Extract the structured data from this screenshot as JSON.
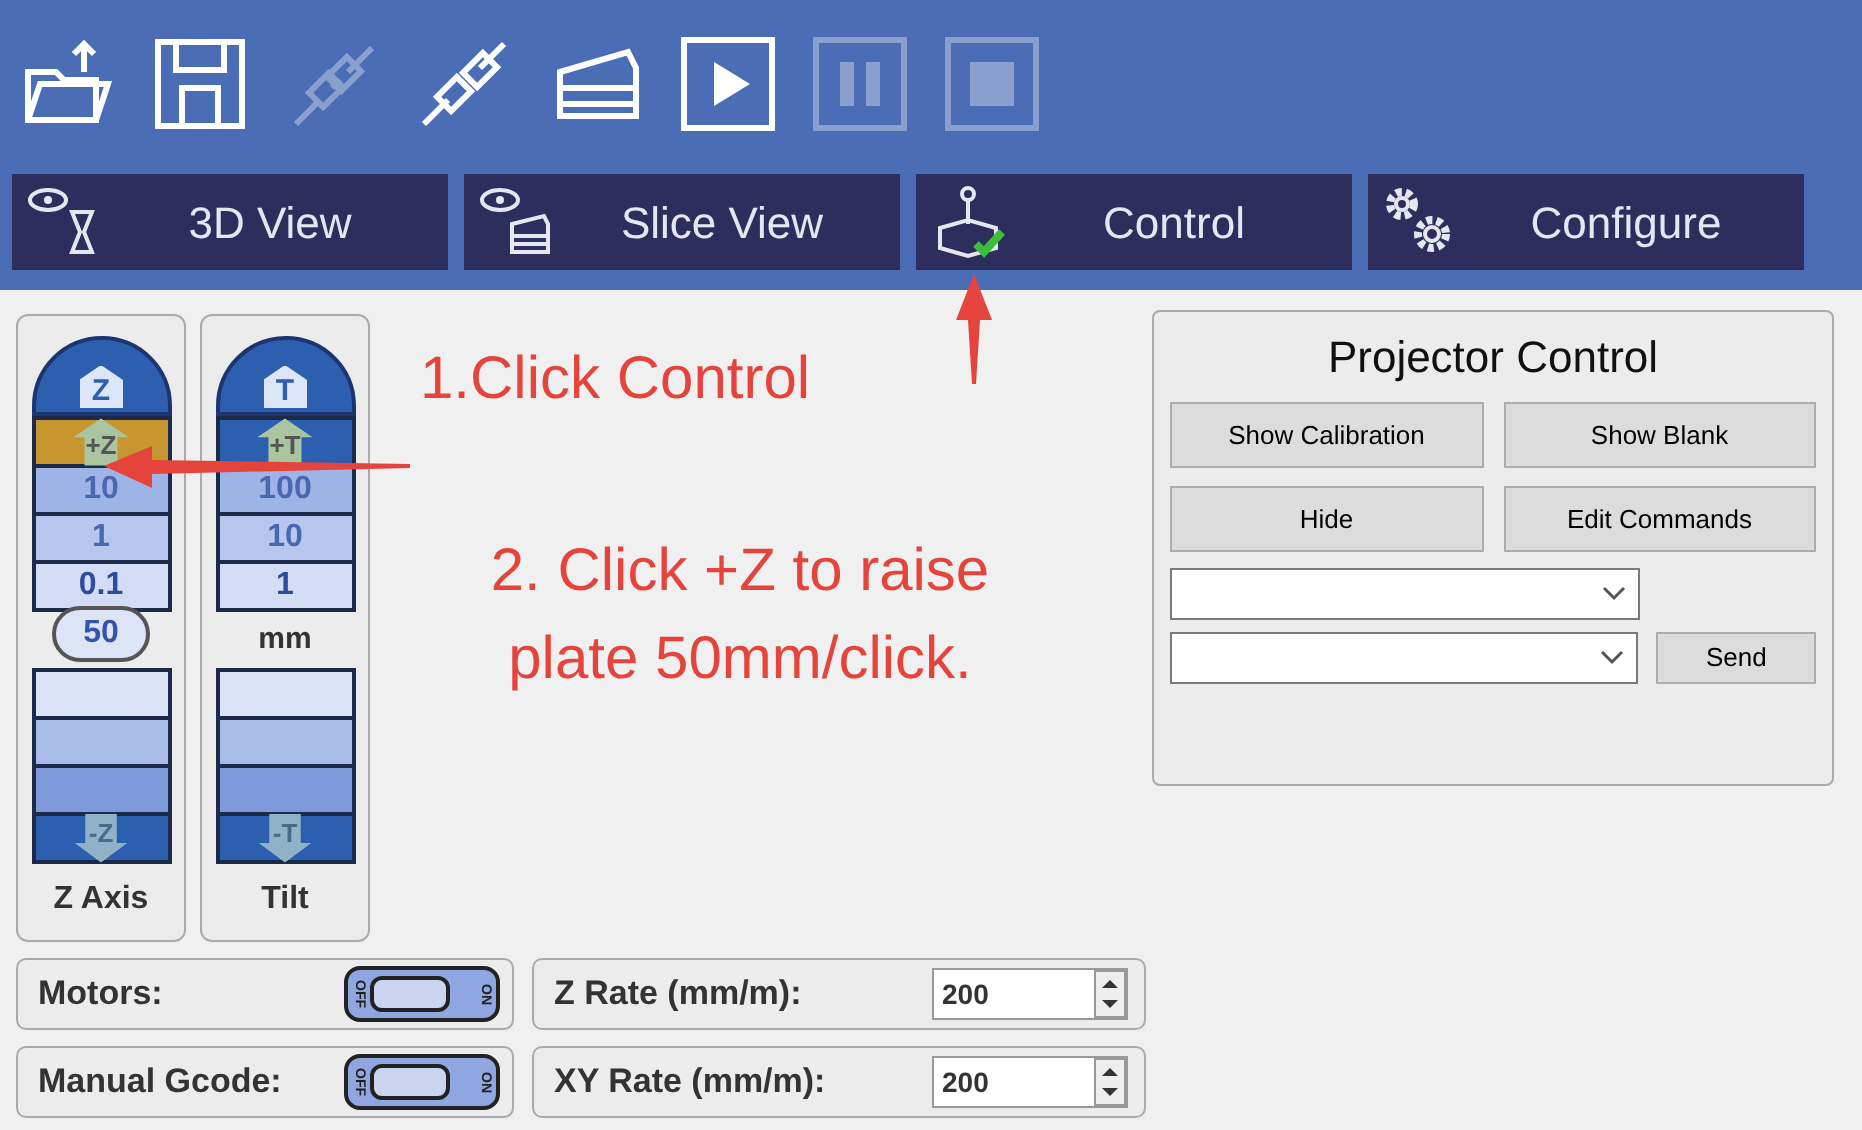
{
  "toolbar": [
    {
      "kind": "open",
      "disabled": false
    },
    {
      "kind": "save",
      "disabled": false
    },
    {
      "kind": "disconnect",
      "disabled": true
    },
    {
      "kind": "connect",
      "disabled": false
    },
    {
      "kind": "slice",
      "disabled": false
    },
    {
      "kind": "play",
      "disabled": false
    },
    {
      "kind": "pause",
      "disabled": true
    },
    {
      "kind": "stop",
      "disabled": true
    }
  ],
  "tabs": [
    {
      "kind": "view3d",
      "label": "3D View"
    },
    {
      "kind": "slice",
      "label": "Slice View"
    },
    {
      "kind": "control",
      "label": "Control"
    },
    {
      "kind": "configure",
      "label": "Configure"
    }
  ],
  "axes": [
    {
      "home": "Z",
      "up": {
        "label": "+Z",
        "highlighted": true
      },
      "steps": [
        "10",
        "1",
        "0.1"
      ],
      "middle": {
        "kind": "cloud",
        "text": "50"
      },
      "down": "-Z",
      "title": "Z Axis"
    },
    {
      "home": "T",
      "up": {
        "label": "+T",
        "highlighted": false
      },
      "steps": [
        "100",
        "10",
        "1"
      ],
      "middle": {
        "kind": "label",
        "text": "mm"
      },
      "down": "-T",
      "title": "Tilt"
    }
  ],
  "annotations": [
    "1.Click Control",
    "2. Click +Z to raise plate 50mm/click."
  ],
  "projector": {
    "title": "Projector Control",
    "buttons": [
      "Show Calibration",
      "Show Blank",
      "Hide",
      "Edit Commands"
    ],
    "send": "Send"
  },
  "settings": [
    {
      "toggle": {
        "label": "Motors:",
        "on": false,
        "off_text": "OFF",
        "on_text": "ON"
      },
      "rate": {
        "label": "Z Rate (mm/m):",
        "value": "200"
      }
    },
    {
      "toggle": {
        "label": "Manual Gcode:",
        "on": false,
        "off_text": "OFF",
        "on_text": "ON"
      },
      "rate": {
        "label": "XY Rate (mm/m):",
        "value": "200"
      }
    }
  ]
}
